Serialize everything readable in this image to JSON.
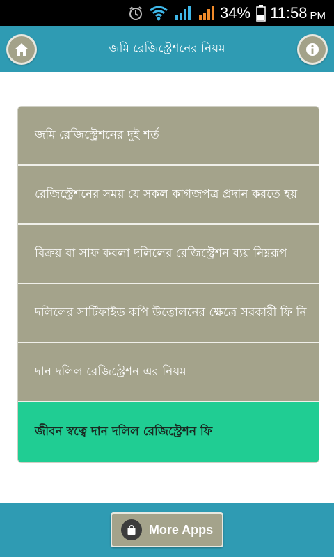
{
  "status_bar": {
    "battery_percent": "34%",
    "time": "11:58",
    "ampm": "PM",
    "icons": [
      "alarm-icon",
      "wifi-icon",
      "signal-icon",
      "signal-icon",
      "battery-icon"
    ]
  },
  "header": {
    "title": "জমি রেজিস্ট্রেশনের নিয়ম",
    "home_icon": "home-icon",
    "info_icon": "info-icon"
  },
  "menu": {
    "items": [
      {
        "label": "জমি রেজিস্ট্রেশনের দুই শর্ত"
      },
      {
        "label": "রেজিস্ট্রেশনের সময় যে সকল কাগজপত্র প্রদান করতে হয়"
      },
      {
        "label": "বিক্রয় বা সাফ কবলা দলিলের রেজিস্ট্রেশন ব্যয় নিম্নরূপ"
      },
      {
        "label": "দলিলের সার্টিফাইড কপি উত্তোলনের ক্ষেত্রে সরকারী ফি নি"
      },
      {
        "label": "দান দলিল রেজিস্ট্রেশন এর নিয়ম"
      },
      {
        "label": "জীবন স্বত্বে দান দলিল রেজিস্ট্রেশন ফি"
      }
    ],
    "active_index": 5
  },
  "footer": {
    "more_apps_label": "More Apps",
    "bag_icon": "shopping-bag-icon"
  },
  "colors": {
    "primary": "#2f9bb3",
    "item_bg": "#a4a38b",
    "active_bg": "#20cd93"
  }
}
